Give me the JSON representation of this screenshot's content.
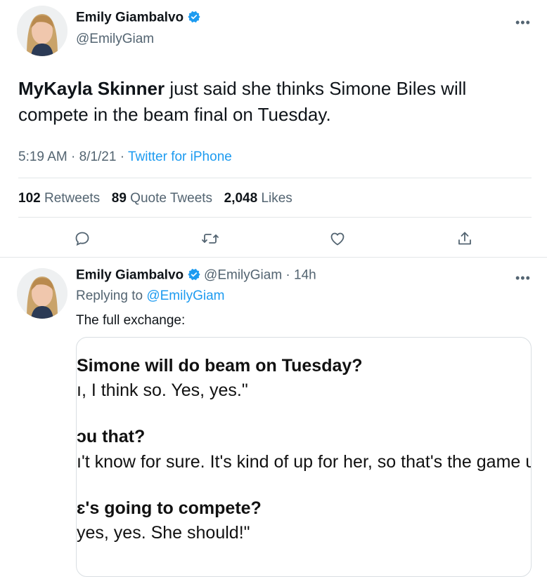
{
  "tweet": {
    "author_name": "Emily Giambalvo",
    "author_handle": "@EmilyGiam",
    "text_bold": "MyKayla Skinner",
    "text_rest_line1": " just said she thinks Simone Biles will",
    "text_line2": "compete in the beam final on Tuesday.",
    "time": "5:19 AM",
    "date": "8/1/21",
    "source": "Twitter for iPhone",
    "retweets_count": "102",
    "retweets_label": "Retweets",
    "quotes_count": "89",
    "quotes_label": "Quote Tweets",
    "likes_count": "2,048",
    "likes_label": "Likes"
  },
  "reply": {
    "author_name": "Emily Giambalvo",
    "author_handle": "@EmilyGiam",
    "age": "14h",
    "replying_prefix": "Replying to ",
    "replying_handle": "@EmilyGiam",
    "text": "The full exchange:",
    "image_lines": {
      "q1": "Simone will do beam on Tuesday?",
      "a1": "ı, I think so. Yes, yes.\"",
      "q2": "ɔu that?",
      "a2": "ı't know for sure. It's kind of up for her, so that's the game ɥ",
      "q3": "ɛ's going to compete?",
      "a3": " yes, yes. She should!\""
    }
  },
  "icons": {
    "verified_color": "#1d9bf0",
    "action_color": "#536471"
  }
}
